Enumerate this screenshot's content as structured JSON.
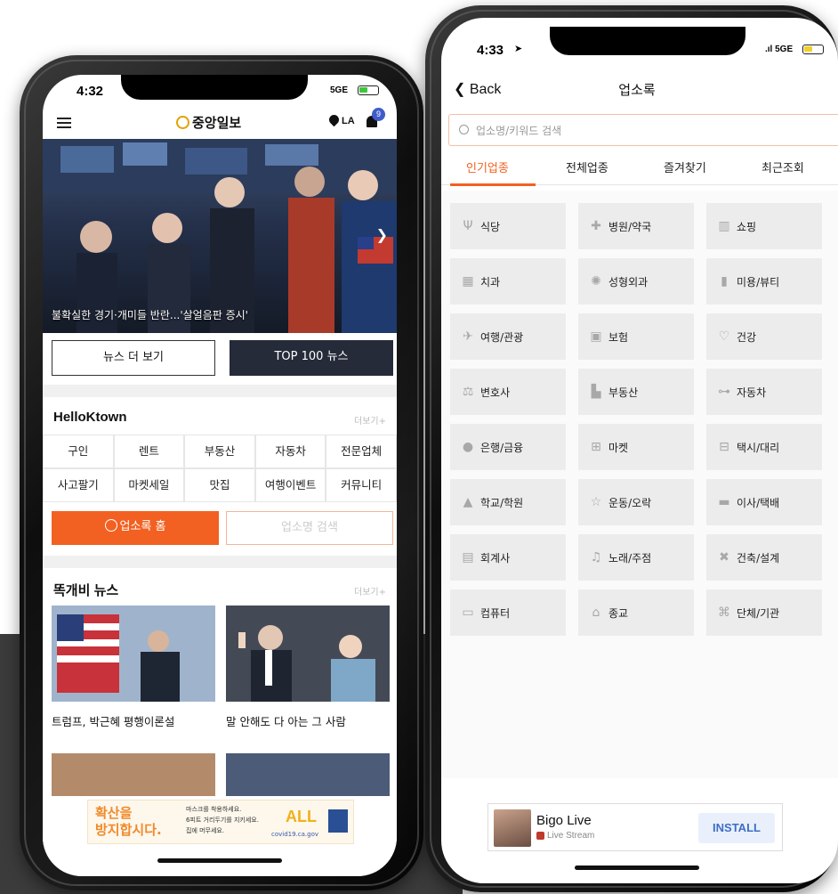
{
  "phone_left": {
    "status": {
      "time": "4:32",
      "network": "5GE"
    },
    "header": {
      "logo": "중앙일보",
      "location": "LA",
      "badge_count": "9"
    },
    "hero_caption": "불확실한 경기·개미들 반란...'살얼음판 증시'",
    "buttons": {
      "more_news": "뉴스 더 보기",
      "top100": "TOP 100 뉴스"
    },
    "helloktown": {
      "title": "HelloKtown",
      "more": "더보기+",
      "items": [
        "구인",
        "렌트",
        "부동산",
        "자동차",
        "전문업체",
        "사고팔기",
        "마켓세일",
        "맛집",
        "여행이벤트",
        "커뮤니티"
      ]
    },
    "directory_buttons": {
      "home": "업소록 홈",
      "search": "업소명 검색"
    },
    "news": {
      "title": "똑개비 뉴스",
      "more": "더보기+",
      "items": [
        "트럼프, 박근혜 평행이론설",
        "말 안해도 다 아는 그 사람"
      ]
    },
    "ad": {
      "line1": "확산을",
      "line2": "방지합시다.",
      "small1": "마스크를 착용하세요.",
      "small2": "6피트 거리두기를 지키세요.",
      "small3": "집에 머무세요.",
      "badge": "ALL",
      "url": "covid19.ca.gov"
    }
  },
  "phone_right": {
    "status": {
      "time": "4:33",
      "network": "5GE"
    },
    "nav": {
      "back": "Back",
      "title": "업소록"
    },
    "search": {
      "placeholder": "업소명/키워드 검색"
    },
    "tabs": [
      "인기업종",
      "전체업종",
      "즐겨찾기",
      "최근조회"
    ],
    "categories": [
      {
        "label": "식당",
        "icon": "utensils-icon"
      },
      {
        "label": "병원/약국",
        "icon": "medical-cross-icon"
      },
      {
        "label": "쇼핑",
        "icon": "shop-icon"
      },
      {
        "label": "치과",
        "icon": "tooth-icon"
      },
      {
        "label": "성형외과",
        "icon": "surgery-icon"
      },
      {
        "label": "미용/뷰티",
        "icon": "beauty-icon"
      },
      {
        "label": "여행/관광",
        "icon": "airplane-icon"
      },
      {
        "label": "보험",
        "icon": "insurance-icon"
      },
      {
        "label": "건강",
        "icon": "heart-icon"
      },
      {
        "label": "변호사",
        "icon": "gavel-icon"
      },
      {
        "label": "부동산",
        "icon": "building-icon"
      },
      {
        "label": "자동차",
        "icon": "car-icon"
      },
      {
        "label": "은행/금융",
        "icon": "money-bag-icon"
      },
      {
        "label": "마켓",
        "icon": "cart-icon"
      },
      {
        "label": "택시/대리",
        "icon": "taxi-icon"
      },
      {
        "label": "학교/학원",
        "icon": "school-icon"
      },
      {
        "label": "운동/오락",
        "icon": "sports-icon"
      },
      {
        "label": "이사/택배",
        "icon": "truck-icon"
      },
      {
        "label": "회계사",
        "icon": "calculator-icon"
      },
      {
        "label": "노래/주점",
        "icon": "music-icon"
      },
      {
        "label": "건축/설계",
        "icon": "tools-icon"
      },
      {
        "label": "컴퓨터",
        "icon": "computer-icon"
      },
      {
        "label": "종교",
        "icon": "church-icon"
      },
      {
        "label": "단체/기관",
        "icon": "institution-icon"
      }
    ],
    "ad": {
      "name": "Bigo Live",
      "sub": "Live Stream",
      "cta": "INSTALL"
    }
  },
  "colors": {
    "accent": "#f26122",
    "dark_button": "#262b3a",
    "badge": "#3f5cc9"
  }
}
